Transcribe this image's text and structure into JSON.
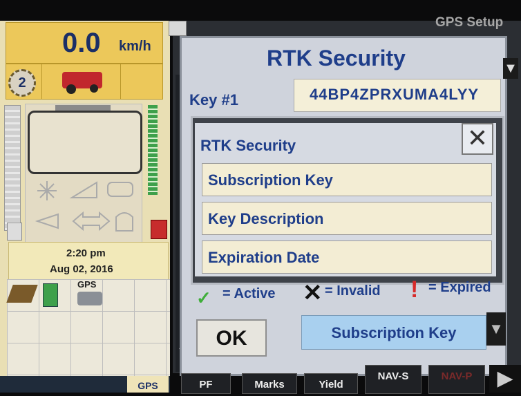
{
  "status": {
    "speed_value": "0.0",
    "speed_unit": "km/h",
    "gear": "2",
    "time": "2:20 pm",
    "date": "Aug 02, 2016",
    "gps_small_label": "GPS"
  },
  "header": {
    "title": "GPS Setup"
  },
  "rtk_dialog": {
    "title": "RTK Security",
    "key1_label": "Key #1",
    "key1_value": "44BP4ZPRXUMA4LYY"
  },
  "popup": {
    "title": "RTK Security",
    "close_glyph": "✕",
    "items": [
      {
        "label": "Subscription Key"
      },
      {
        "label": "Key Description"
      },
      {
        "label": "Expiration Date"
      }
    ]
  },
  "legend": {
    "active": "= Active",
    "invalid": "= Invalid",
    "expired": "= Expired",
    "check_glyph": "✓",
    "x_glyph": "✕",
    "exclaim_glyph": "!"
  },
  "actions": {
    "ok_label": "OK",
    "selected_option": "Subscription Key",
    "dropdown_glyph": "▼"
  },
  "tabs": [
    {
      "label": "GPS"
    },
    {
      "label": "PF"
    },
    {
      "label": "Marks"
    },
    {
      "label": "Yield"
    },
    {
      "label": "NAV-S"
    },
    {
      "label": "NAV-P"
    }
  ],
  "colors": {
    "accent_blue": "#1f3e8a",
    "panel_yellow": "#ecc85a",
    "active_green": "#3fae3a",
    "expired_red": "#d72a2a",
    "selected_blue": "#a9d0ef"
  }
}
